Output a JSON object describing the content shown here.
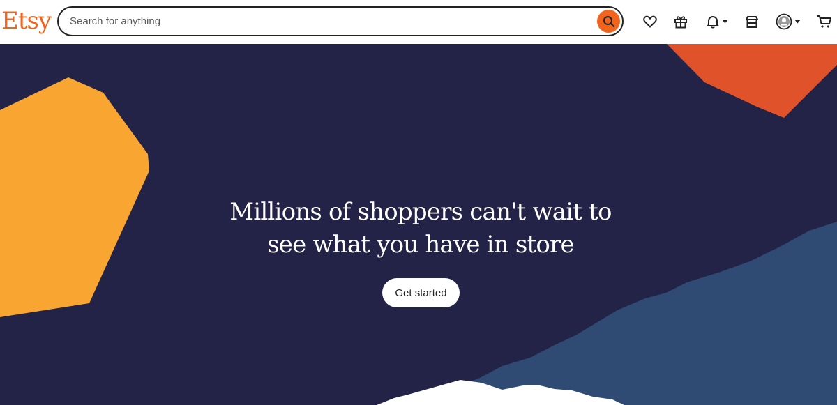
{
  "header": {
    "logo": "Etsy",
    "search": {
      "placeholder": "Search for anything",
      "value": ""
    },
    "icons": [
      "search-icon",
      "heart-icon",
      "gift-icon",
      "bell-icon",
      "shop-icon",
      "account-icon",
      "cart-icon"
    ]
  },
  "hero": {
    "headline_line1": "Millions of shoppers can't wait to",
    "headline_line2": "see what you have in store",
    "cta_label": "Get started"
  },
  "colors": {
    "brand": "#f1641e",
    "hero_bg": "#232347",
    "shape_orange": "#f9a532",
    "shape_red": "#e0532a",
    "shape_blue": "#2f4a73"
  }
}
